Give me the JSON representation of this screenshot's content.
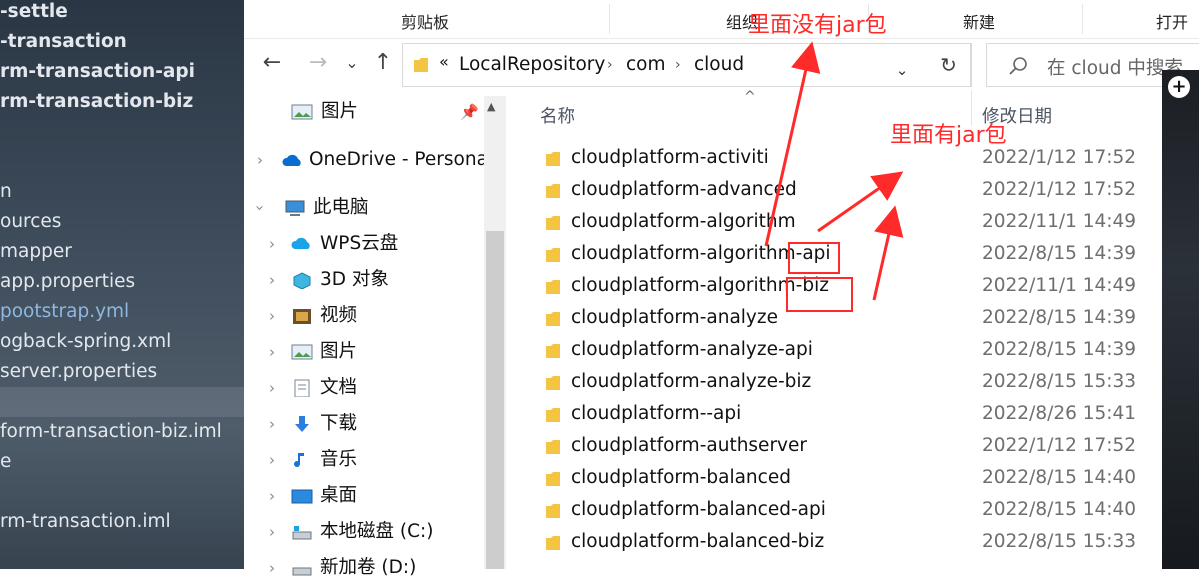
{
  "ide_tree": {
    "rows": [
      {
        "text": "-settle",
        "style": "bold"
      },
      {
        "text": "-transaction",
        "style": "bold"
      },
      {
        "text": "rm-transaction-api",
        "style": "bold"
      },
      {
        "text": "rm-transaction-biz",
        "style": "bold"
      },
      {
        "text": "",
        "style": ""
      },
      {
        "text": "n",
        "style": ""
      },
      {
        "text": "ources",
        "style": ""
      },
      {
        "text": "mapper",
        "style": ""
      },
      {
        "text": "app.properties",
        "style": ""
      },
      {
        "text": "pootstrap.yml",
        "style": "blue"
      },
      {
        "text": "ogback-spring.xml",
        "style": ""
      },
      {
        "text": "server.properties",
        "style": ""
      },
      {
        "text": "",
        "style": "sel"
      },
      {
        "text": "form-transaction-biz.iml",
        "style": ""
      },
      {
        "text": "e",
        "style": ""
      },
      {
        "text": "",
        "style": ""
      },
      {
        "text": "rm-transaction.iml",
        "style": ""
      }
    ]
  },
  "ribbon": {
    "clipboard": "剪贴板",
    "organize": "组织",
    "new": "新建",
    "open": "打开"
  },
  "navigation": {
    "back_icon": "←",
    "forward_icon": "→",
    "recent_icon": "⌄",
    "up_icon": "↑",
    "address_overflow": "«",
    "breadcrumbs": [
      "LocalRepository",
      "com",
      "cloud"
    ],
    "refresh_icon": "↻",
    "search_placeholder": "在 cloud 中搜索"
  },
  "nav_pane": {
    "quick_pictures": "图片",
    "onedrive": "OneDrive - Personal",
    "this_pc": "此电脑",
    "items": [
      "WPS云盘",
      "3D 对象",
      "视频",
      "图片",
      "文档",
      "下载",
      "音乐",
      "桌面",
      "本地磁盘 (C:)",
      "新加卷 (D:)"
    ]
  },
  "columns": {
    "name": "名称",
    "modified": "修改日期"
  },
  "files": [
    {
      "name": "cloudplatform-activiti",
      "date": "2022/1/12 17:52"
    },
    {
      "name": "cloudplatform-advanced",
      "date": "2022/1/12 17:52"
    },
    {
      "name": "cloudplatform-algorithm",
      "date": "2022/11/1 14:49"
    },
    {
      "name": "cloudplatform-algorithm-api",
      "date": "2022/8/15 14:39"
    },
    {
      "name": "cloudplatform-algorithm-biz",
      "date": "2022/11/1 14:49"
    },
    {
      "name": "cloudplatform-analyze",
      "date": "2022/8/15 14:39"
    },
    {
      "name": "cloudplatform-analyze-api",
      "date": "2022/8/15 14:39"
    },
    {
      "name": "cloudplatform-analyze-biz",
      "date": "2022/8/15 15:33"
    },
    {
      "name": "cloudplatform--api",
      "date": "2022/8/26 15:41"
    },
    {
      "name": "cloudplatform-authserver",
      "date": "2022/1/12 17:52"
    },
    {
      "name": "cloudplatform-balanced",
      "date": "2022/8/15 14:40"
    },
    {
      "name": "cloudplatform-balanced-api",
      "date": "2022/8/15 14:40"
    },
    {
      "name": "cloudplatform-balanced-biz",
      "date": "2022/8/15 15:33"
    }
  ],
  "annotations": {
    "no_jar": "里面没有jar包",
    "has_jar": "里面有jar包"
  },
  "colors": {
    "annotation_red": "#ff2a2a",
    "folder_yellow": "#f4c542",
    "onedrive_blue": "#0a6ed1"
  }
}
